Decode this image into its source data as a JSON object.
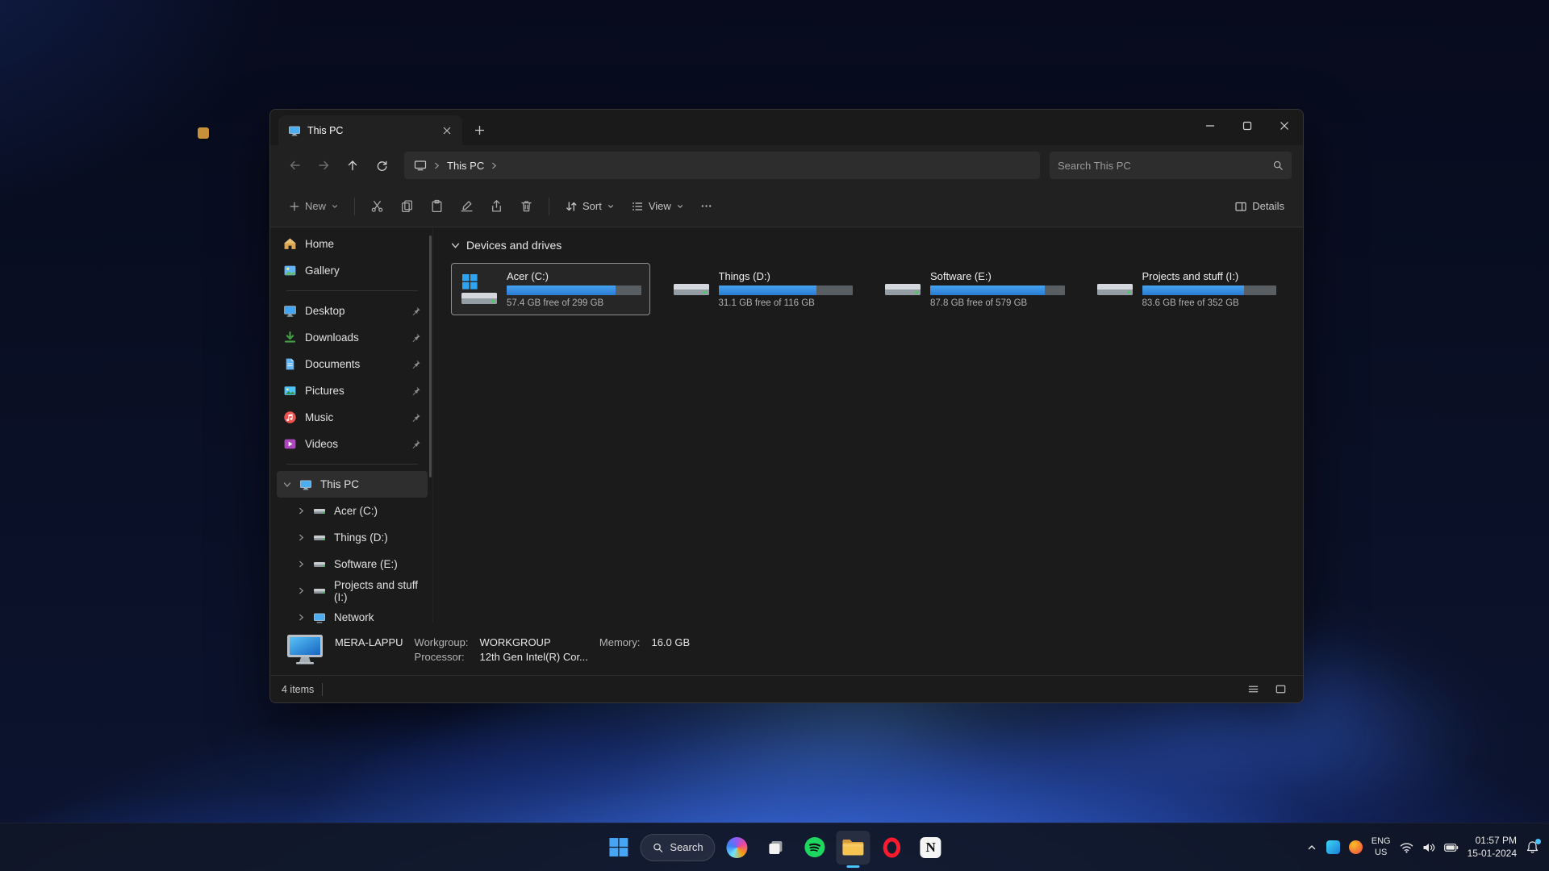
{
  "window": {
    "tab": {
      "title": "This PC"
    },
    "nav": {
      "breadcrumb_root": "This PC",
      "search_placeholder": "Search This PC"
    },
    "toolbar": {
      "new": "New",
      "sort": "Sort",
      "view": "View",
      "details": "Details"
    },
    "sidebar": {
      "items_top": [
        {
          "label": "Home"
        },
        {
          "label": "Gallery"
        }
      ],
      "pinned": [
        {
          "label": "Desktop"
        },
        {
          "label": "Downloads"
        },
        {
          "label": "Documents"
        },
        {
          "label": "Pictures"
        },
        {
          "label": "Music"
        },
        {
          "label": "Videos"
        }
      ],
      "tree_root": {
        "label": "This PC"
      },
      "tree_children": [
        {
          "label": "Acer (C:)"
        },
        {
          "label": "Things (D:)"
        },
        {
          "label": "Software (E:)"
        },
        {
          "label": "Projects and stuff (I:)"
        },
        {
          "label": "Network"
        }
      ]
    },
    "content": {
      "section": "Devices and drives",
      "drives": [
        {
          "name": "Acer (C:)",
          "free": "57.4 GB free of 299 GB",
          "used_pct": 81,
          "selected": true
        },
        {
          "name": "Things (D:)",
          "free": "31.1 GB free of 116 GB",
          "used_pct": 73,
          "selected": false
        },
        {
          "name": "Software (E:)",
          "free": "87.8 GB free of 579 GB",
          "used_pct": 85,
          "selected": false
        },
        {
          "name": "Projects and stuff (I:)",
          "free": "83.6 GB free of 352 GB",
          "used_pct": 76,
          "selected": false
        }
      ]
    },
    "info_panel": {
      "computer_name": "MERA-LAPPU",
      "workgroup_label": "Workgroup:",
      "workgroup_value": "WORKGROUP",
      "processor_label": "Processor:",
      "processor_value": "12th Gen Intel(R) Cor...",
      "memory_label": "Memory:",
      "memory_value": "16.0 GB"
    },
    "status_bar": {
      "items_count": "4 items"
    }
  },
  "taskbar": {
    "search_label": "Search",
    "tray": {
      "lang_top": "ENG",
      "lang_bottom": "US",
      "time": "01:57 PM",
      "date": "15-01-2024"
    }
  },
  "colors": {
    "accent_bar": "#2f86e0",
    "taskbar_indicator": "#4cc2ff",
    "selection_border": "#8f8f8f"
  }
}
